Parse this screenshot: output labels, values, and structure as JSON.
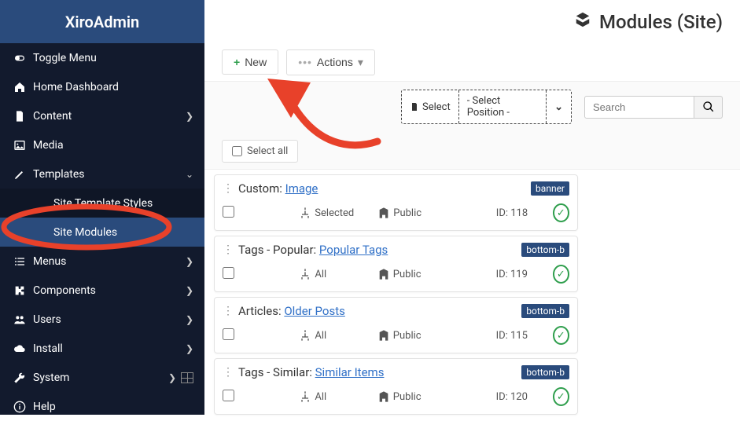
{
  "brand": "XiroAdmin",
  "page_title": "Modules (Site)",
  "sidebar": [
    {
      "icon": "toggle",
      "label": "Toggle Menu",
      "chev": "",
      "sub": false,
      "active": false
    },
    {
      "icon": "home",
      "label": "Home Dashboard",
      "chev": "",
      "sub": false,
      "active": false
    },
    {
      "icon": "doc",
      "label": "Content",
      "chev": ">",
      "sub": false,
      "active": false
    },
    {
      "icon": "image",
      "label": "Media",
      "chev": "",
      "sub": false,
      "active": false
    },
    {
      "icon": "pencil",
      "label": "Templates",
      "chev": "v",
      "sub": false,
      "active": false
    },
    {
      "icon": "",
      "label": "Site Template Styles",
      "chev": "",
      "sub": true,
      "active": false
    },
    {
      "icon": "",
      "label": "Site Modules",
      "chev": "",
      "sub": true,
      "active": true
    },
    {
      "icon": "list",
      "label": "Menus",
      "chev": ">",
      "sub": false,
      "active": false
    },
    {
      "icon": "puzzle",
      "label": "Components",
      "chev": ">",
      "sub": false,
      "active": false
    },
    {
      "icon": "users",
      "label": "Users",
      "chev": ">",
      "sub": false,
      "active": false
    },
    {
      "icon": "cloud",
      "label": "Install",
      "chev": ">",
      "sub": false,
      "active": false
    },
    {
      "icon": "wrench",
      "label": "System",
      "chev": ">",
      "sub": false,
      "active": false,
      "gridicon": true
    },
    {
      "icon": "info",
      "label": "Help",
      "chev": "",
      "sub": false,
      "active": false
    }
  ],
  "toolbar": {
    "new_label": "New",
    "actions_label": "Actions"
  },
  "filter": {
    "select_label": "Select",
    "position_label": "- Select Position -",
    "search_placeholder": "Search",
    "select_all_label": "Select all"
  },
  "modules": [
    {
      "kind": "Custom",
      "link": "Image",
      "badge": "banner",
      "assign": "Selected",
      "access": "Public",
      "id": "ID: 118"
    },
    {
      "kind": "Tags - Popular",
      "link": "Popular Tags",
      "badge": "bottom-b",
      "assign": "All",
      "access": "Public",
      "id": "ID: 119"
    },
    {
      "kind": "Articles",
      "link": "Older Posts",
      "badge": "bottom-b",
      "assign": "All",
      "access": "Public",
      "id": "ID: 115"
    },
    {
      "kind": "Tags - Similar",
      "link": "Similar Items",
      "badge": "bottom-b",
      "assign": "All",
      "access": "Public",
      "id": "ID: 120"
    }
  ]
}
